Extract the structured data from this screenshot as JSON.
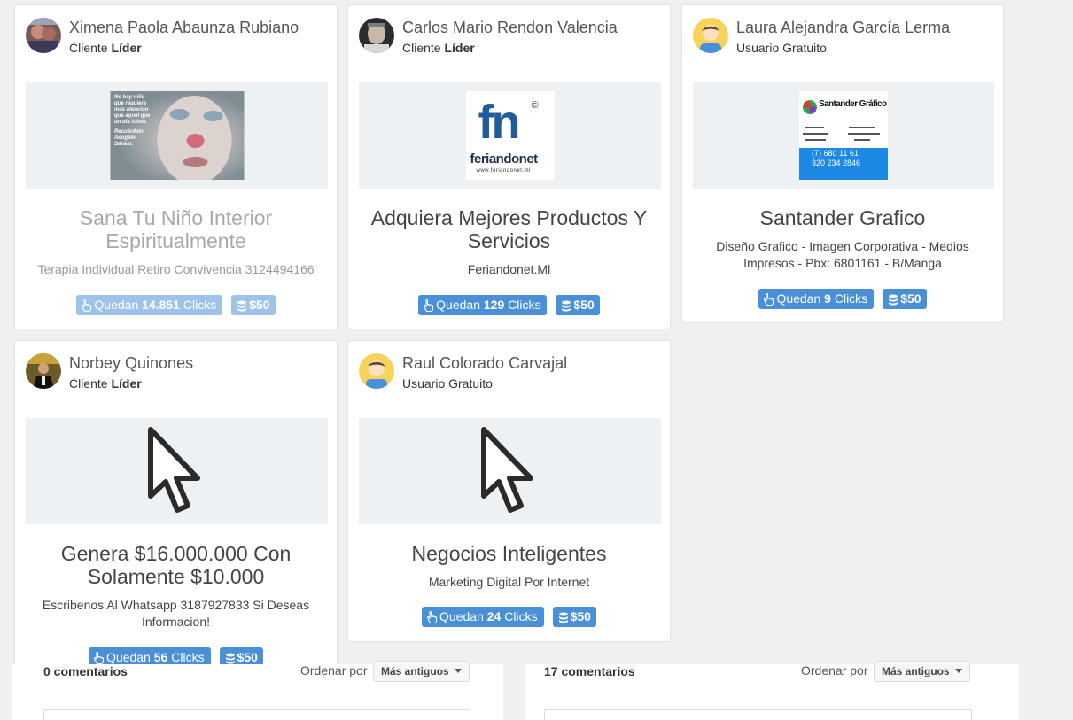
{
  "cards": [
    {
      "user": "Ximena Paola Abaunza Rubiano",
      "role_prefix": "Cliente",
      "role_bold": "Líder",
      "title": "Sana Tu Niño Interior Espiritualmente",
      "desc": "Terapia Individual Retiro Convivencia 3124494166",
      "clicks_prefix": "Quedan",
      "clicks_count": "14.851",
      "clicks_suffix": "Clicks",
      "price": "$50",
      "ad_text": [
        "No hay niño",
        "que requiera",
        "más atención",
        "que aquel que",
        "un día fuiste.",
        "Recuérdalo.",
        "Acógelo.",
        "Sánalo."
      ]
    },
    {
      "user": "Carlos Mario Rendon Valencia",
      "role_prefix": "Cliente",
      "role_bold": "Líder",
      "title": "Adquiera Mejores Productos Y Servicios",
      "desc": "Feriandonet.Ml",
      "clicks_prefix": "Quedan",
      "clicks_count": "129",
      "clicks_suffix": "Clicks",
      "price": "$50",
      "logo_big": "fn",
      "logo_name": "feriandonet",
      "logo_url": "www.feriandonet.ml"
    },
    {
      "user": "Laura Alejandra García Lerma",
      "role_prefix": "Usuario Gratuito",
      "role_bold": "",
      "title": "Santander Grafico",
      "desc": "Diseño Grafico - Imagen Corporativa - Medios Impresos - Pbx: 6801161 - B/Manga",
      "clicks_prefix": "Quedan",
      "clicks_count": "9",
      "clicks_suffix": "Clicks",
      "price": "$50",
      "ad_brand": "Santander Gráfico",
      "ad_phone1": "(7) 680 11 61",
      "ad_phone2": "320 234 2846"
    },
    {
      "user": "Norbey Quinones",
      "role_prefix": "Cliente",
      "role_bold": "Líder",
      "title": "Genera $16.000.000 Con Solamente $10.000",
      "desc": "Escribenos Al Whatsapp 3187927833 Si Deseas Informacion!",
      "clicks_prefix": "Quedan",
      "clicks_count": "56",
      "clicks_suffix": "Clicks",
      "price": "$50"
    },
    {
      "user": "Raul Colorado Carvajal",
      "role_prefix": "Usuario Gratuito",
      "role_bold": "",
      "title": "Negocios Inteligentes",
      "desc": "Marketing Digital Por Internet",
      "clicks_prefix": "Quedan",
      "clicks_count": "24",
      "clicks_suffix": "Clicks",
      "price": "$50"
    }
  ],
  "comments": [
    {
      "count": "0 comentarios",
      "order_label": "Ordenar por",
      "order_value": "Más antiguos"
    },
    {
      "count": "17 comentarios",
      "order_label": "Ordenar por",
      "order_value": "Más antiguos"
    }
  ],
  "colors": {
    "accent": "#4a90d9",
    "accent_faded": "#9ec3ea",
    "panel": "#eef1f4",
    "background": "#f0f0f0"
  }
}
